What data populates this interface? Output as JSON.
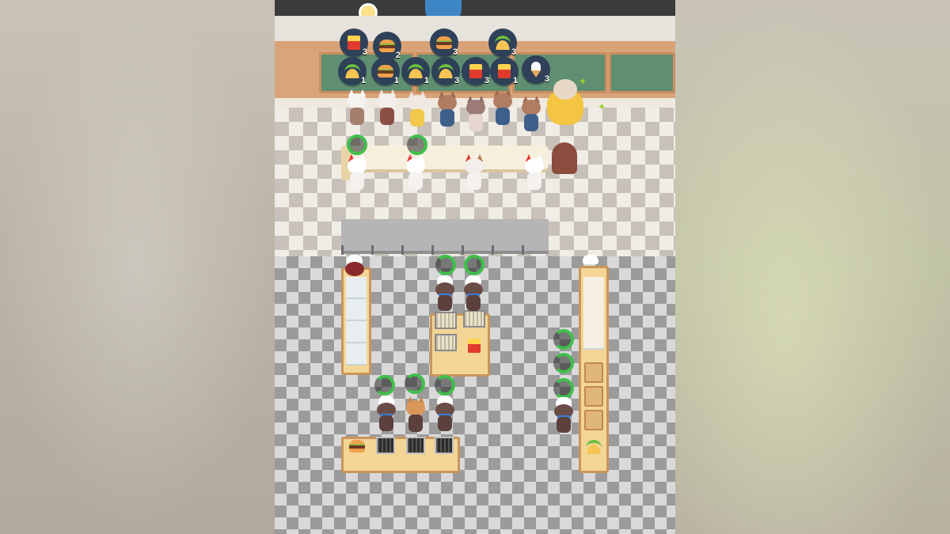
{
  "scene": {
    "type": "restaurant-cooking-game",
    "palette": {
      "ring": "#3fbf4b",
      "bubble": "#2e4158",
      "counter": "#f3d696"
    }
  },
  "orders": [
    {
      "food": "fries-icon",
      "count": "3"
    },
    {
      "food": "burger-icon",
      "count": "2"
    },
    {
      "food": "burger-icon",
      "count": "3"
    },
    {
      "food": "taco-icon",
      "count": "3"
    },
    {
      "food": "taco-icon",
      "count": "1"
    },
    {
      "food": "burger-icon",
      "count": "1"
    },
    {
      "food": "taco-icon",
      "count": "1"
    },
    {
      "food": "taco-icon",
      "count": "3"
    },
    {
      "food": "fries-icon",
      "count": "3"
    },
    {
      "food": "fries-icon",
      "count": "1"
    },
    {
      "food": "ice-cream-icon",
      "count": "3"
    }
  ]
}
